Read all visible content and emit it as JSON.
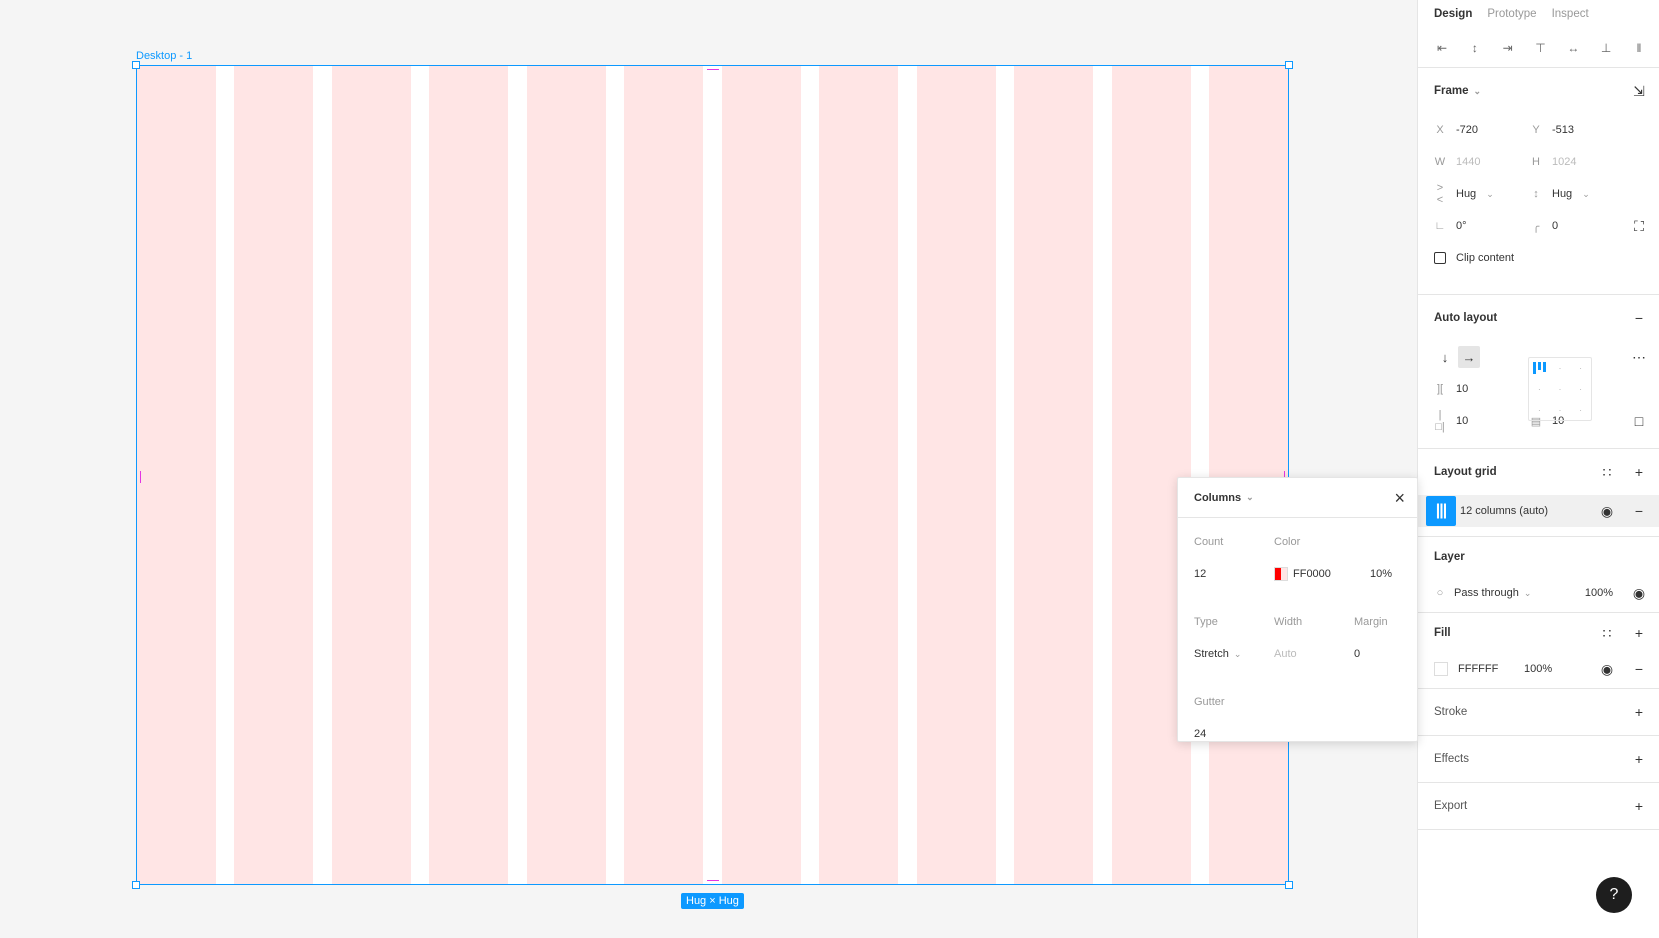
{
  "canvas": {
    "frame_label": "Desktop - 1",
    "size_badge": "Hug × Hug",
    "grid_color": "#FF0000",
    "selection_color": "#0d99ff"
  },
  "popover": {
    "title": "Columns",
    "count_label": "Count",
    "count": "12",
    "color_label": "Color",
    "color_hex": "FF0000",
    "color_opacity": "10%",
    "type_label": "Type",
    "type": "Stretch",
    "width_label": "Width",
    "width": "Auto",
    "margin_label": "Margin",
    "margin": "0",
    "gutter_label": "Gutter",
    "gutter": "24"
  },
  "panel": {
    "tabs": [
      "Design",
      "Prototype",
      "Inspect"
    ],
    "frame": {
      "title": "Frame",
      "x_label": "X",
      "x": "-720",
      "y_label": "Y",
      "y": "-513",
      "w_label": "W",
      "w": "1440",
      "h_label": "H",
      "h": "1024",
      "h_sizing": "Hug",
      "v_sizing": "Hug",
      "rotation": "0°",
      "radius": "0",
      "clip_label": "Clip content"
    },
    "auto_layout": {
      "title": "Auto layout",
      "spacing": "10",
      "pad_h": "10",
      "pad_v": "10"
    },
    "layout_grid": {
      "title": "Layout grid",
      "item": "12 columns (auto)"
    },
    "layer": {
      "title": "Layer",
      "blend": "Pass through",
      "opacity": "100%"
    },
    "fill": {
      "title": "Fill",
      "hex": "FFFFFF",
      "opacity": "100%"
    },
    "stroke": {
      "title": "Stroke"
    },
    "effects": {
      "title": "Effects"
    },
    "export": {
      "title": "Export"
    }
  },
  "help": "?"
}
